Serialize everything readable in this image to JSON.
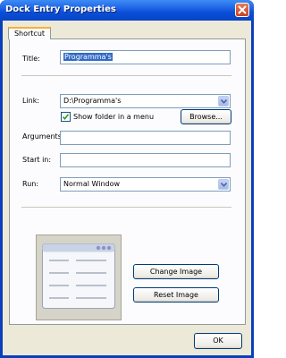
{
  "window": {
    "title": "Dock Entry Properties"
  },
  "tabs": [
    {
      "label": "Shortcut"
    }
  ],
  "form": {
    "title_label": "Title:",
    "title_value": "Programma's",
    "link_label": "Link:",
    "link_value": "D:\\Programma's",
    "show_folder_label": "Show folder in a menu",
    "show_folder_checked": true,
    "browse_label": "Browse...",
    "arguments_label": "Arguments:",
    "arguments_value": "",
    "startin_label": "Start in:",
    "startin_value": "",
    "run_label": "Run:",
    "run_value": "Normal Window"
  },
  "image": {
    "change_label": "Change Image",
    "reset_label": "Reset Image"
  },
  "footer": {
    "ok_label": "OK"
  },
  "colors": {
    "titlebar": "#0a4fd8",
    "face": "#ece9d8",
    "accent_tab": "#f7b036",
    "selection": "#316ac5"
  },
  "icons": {
    "close": "close-icon",
    "dropdown": "chevron-down-icon",
    "check": "check-icon"
  }
}
